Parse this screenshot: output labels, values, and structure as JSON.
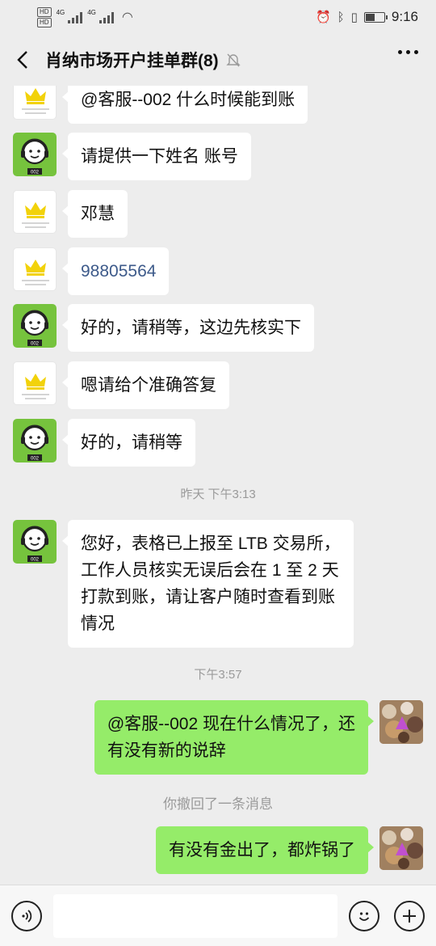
{
  "status": {
    "hd1": "HD",
    "hd2": "HD",
    "net1": "4G",
    "net2": "4G",
    "time": "9:16",
    "battery_level": 0.45
  },
  "header": {
    "title": "肖纳市场开户挂单群(8)"
  },
  "messages": [
    {
      "text": "@客服--002  什么时候能到账"
    },
    {
      "text": "请提供一下姓名 账号"
    },
    {
      "text": "邓慧"
    },
    {
      "text": "98805564"
    },
    {
      "text": "好的，请稍等，这边先核实下"
    },
    {
      "text": "嗯请给个准确答复"
    },
    {
      "text": "好的，请稍等"
    },
    {
      "lines": [
        "您好，表格已上报至 LTB 交易所，",
        "工作人员核实无误后会在 1 至 2 天",
        "打款到账，请让客户随时查看到账",
        "情况"
      ]
    },
    {
      "lines": [
        "@客服--002  现在什么情况了，还",
        "有没有新的说辞"
      ]
    },
    {
      "text": "有没有金出了，都炸锅了"
    }
  ],
  "timestamps": {
    "t1": "昨天 下午3:13",
    "t2": "下午3:57"
  },
  "system": {
    "recalled": "你撤回了一条消息"
  },
  "avatars": {
    "service_label": "002"
  },
  "colors": {
    "bg": "#ededed",
    "bubble_in": "#ffffff",
    "bubble_out": "#95ec69",
    "service_avatar": "#76c33d"
  }
}
